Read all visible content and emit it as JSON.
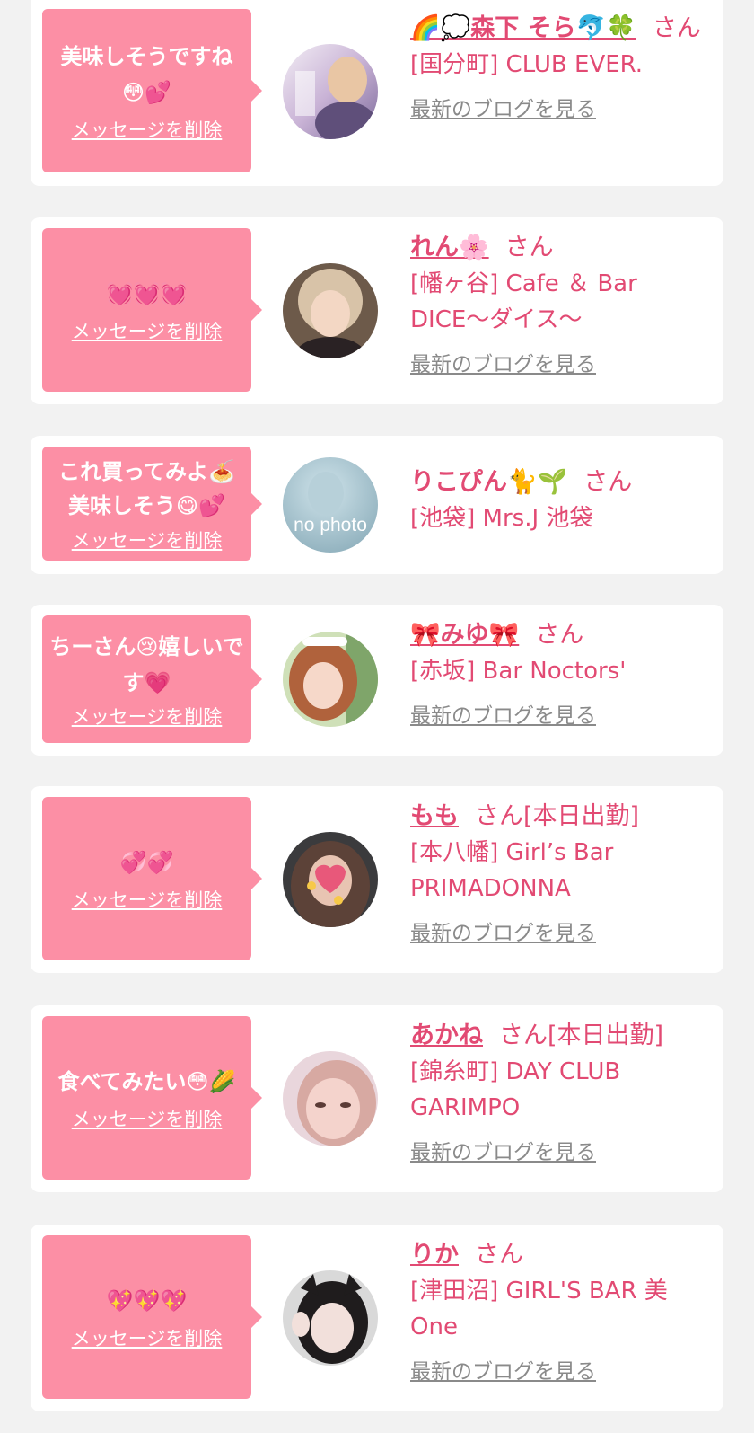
{
  "delete_label": "メッセージを削除",
  "blog_label": "最新のブログを見る",
  "san": "さん",
  "items": [
    {
      "message": "美味しそうですね😳💕",
      "name": "🌈💭森下 そら🐬🍀",
      "status": "",
      "shop": "[国分町] CLUB EVER.",
      "show_blog": true,
      "avatar_desc": "portrait photo with text 森下"
    },
    {
      "message": "💓💓💓",
      "name": "れん🌸",
      "status": "",
      "shop": "[幡ヶ谷] Cafe ＆ Bar DICE〜ダイス〜",
      "show_blog": true,
      "avatar_desc": "portrait photo"
    },
    {
      "message": "これ買ってみよ🍝美味しそう😋💕",
      "name": "りこぴん🐈🌱",
      "status": "",
      "shop": "[池袋] Mrs.J 池袋",
      "show_blog": false,
      "avatar_text": "no photo"
    },
    {
      "message": "ちーさん😢嬉しいです💗",
      "name": "🎀みゆ🎀",
      "status": "",
      "shop": "[赤坂] Bar Noctors'",
      "show_blog": true,
      "avatar_desc": "portrait photo"
    },
    {
      "message": "💞💞",
      "name": "もも",
      "status": "[本日出勤]",
      "shop": "[本八幡] Girl’s Bar PRIMADONNA",
      "show_blog": true,
      "avatar_desc": "portrait photo"
    },
    {
      "message": "食べてみたい😳🌽",
      "name": "あかね",
      "status": "[本日出勤]",
      "shop": "[錦糸町] DAY CLUB GARIMPO",
      "show_blog": true,
      "avatar_desc": "portrait photo"
    },
    {
      "message": "💖💖💖",
      "name": "りか",
      "status": "",
      "shop": "[津田沼] GIRL'S BAR 美One",
      "show_blog": true,
      "avatar_desc": "portrait photo"
    }
  ],
  "colors": {
    "page_bg": "#f2f2f2",
    "card_bg": "#ffffff",
    "bubble_bg": "#fc8fa5",
    "name_color": "#e24a73",
    "blog_color": "#8a8a8a"
  }
}
